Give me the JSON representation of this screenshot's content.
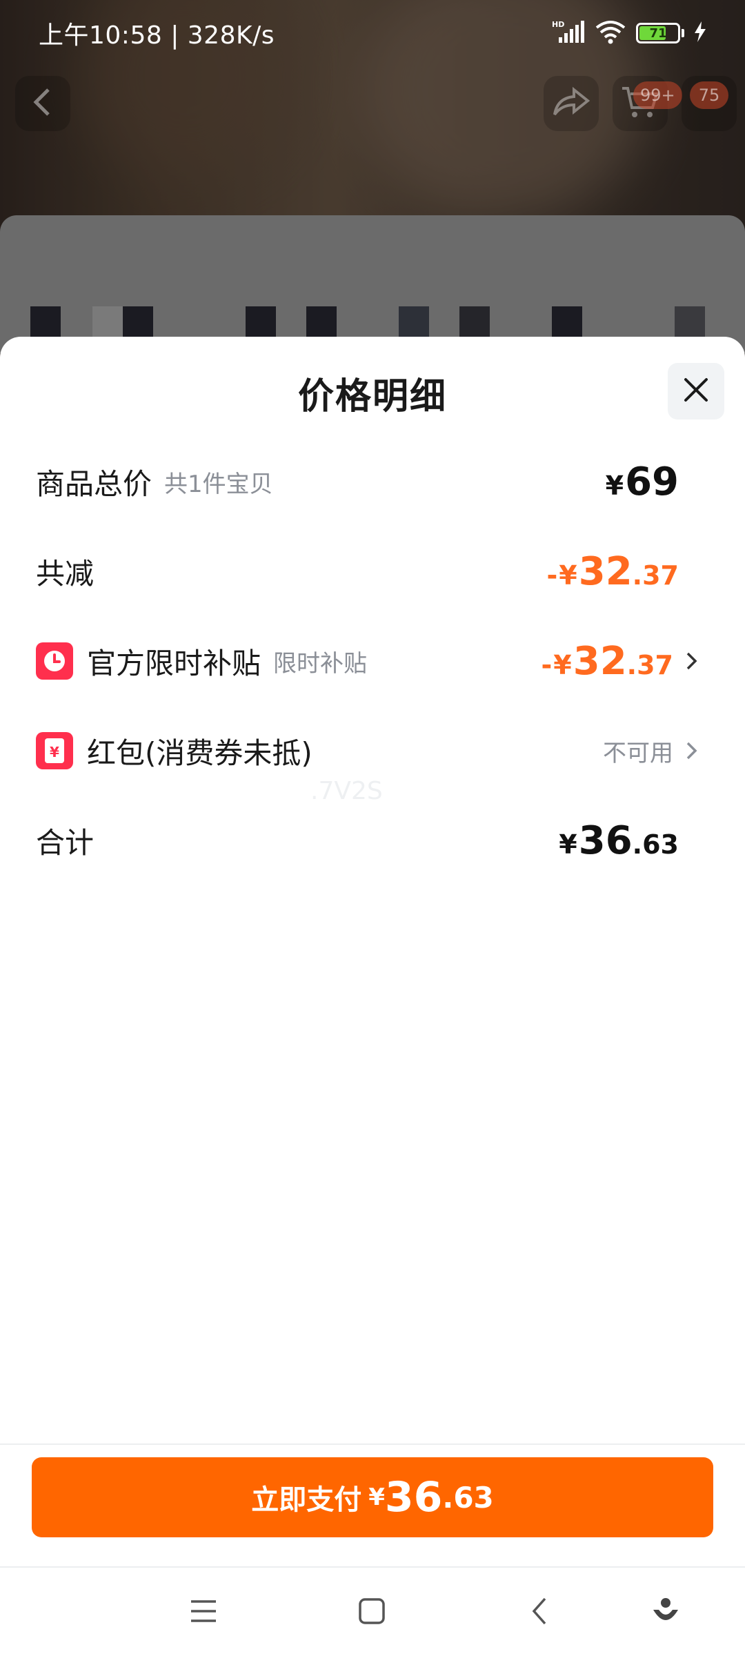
{
  "status": {
    "time": "上午10:58",
    "speed": "328K/s",
    "battery": "71"
  },
  "nav": {
    "cart_badge": "99+",
    "msg_badge": "75"
  },
  "sheet": {
    "title": "价格明细",
    "rows": [
      {
        "label": "商品总价",
        "sub": "共1件宝贝",
        "yen": "¥",
        "int": "69",
        "dec": ""
      },
      {
        "label": "共减",
        "prefix": "-",
        "yen": "¥",
        "int": "32",
        "dec": ".37"
      },
      {
        "label": "官方限时补贴",
        "sub": "限时补贴",
        "prefix": "-",
        "yen": "¥",
        "int": "32",
        "dec": ".37"
      },
      {
        "label": "红包(消费券未抵)",
        "status": "不可用"
      },
      {
        "label": "合计",
        "yen": "¥",
        "int": "36",
        "dec": ".63"
      }
    ],
    "watermark": ".7V2S"
  },
  "footer": {
    "pay_label": "立即支付",
    "yen": "¥",
    "int": "36",
    "dec": ".63"
  },
  "colors": {
    "accent": "#ff6600",
    "discount": "#ff6a1f",
    "icon_red": "#ff2f4d"
  }
}
